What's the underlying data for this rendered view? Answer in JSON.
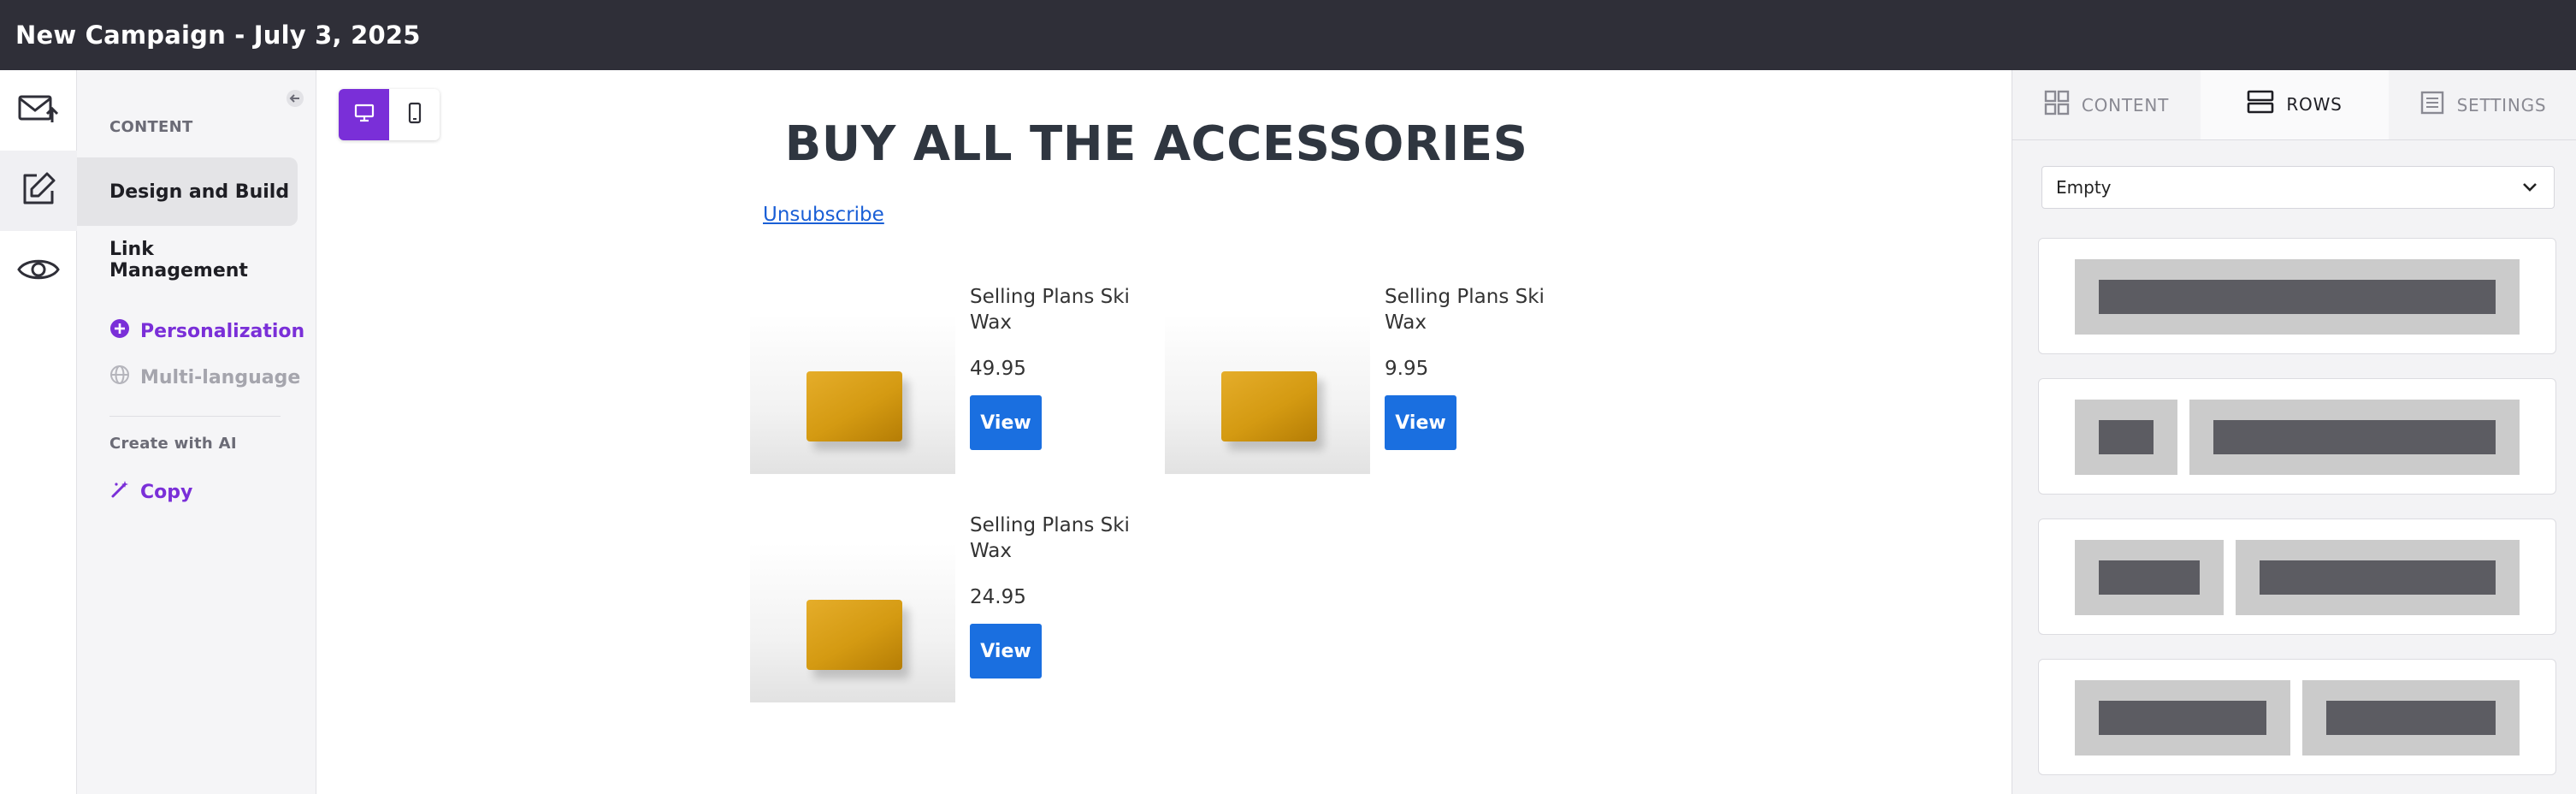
{
  "app": {
    "title": "New Campaign - July 3, 2025"
  },
  "rail": {
    "items": [
      {
        "name": "send-icon",
        "active": false
      },
      {
        "name": "edit-icon",
        "active": true
      },
      {
        "name": "preview-icon",
        "active": false
      }
    ]
  },
  "sidebar": {
    "section_label": "CONTENT",
    "items": [
      {
        "label": "Design and Build",
        "active": true
      },
      {
        "label": "Link Management",
        "active": false
      }
    ],
    "personalization": "Personalization",
    "multi_language": "Multi-language",
    "ai_label": "Create with AI",
    "copy": "Copy",
    "colors": {
      "accent": "#7a2fd8",
      "muted": "#a5a5ad"
    }
  },
  "canvas": {
    "device_toggle": {
      "desktop": "desktop-icon",
      "mobile": "mobile-icon",
      "selected": "desktop"
    },
    "email": {
      "headline": "BUY ALL THE ACCESSORIES",
      "unsubscribe": "Unsubscribe",
      "products": [
        {
          "name": "Selling Plans Ski Wax",
          "price": "49.95",
          "button": "View"
        },
        {
          "name": "Selling Plans Ski Wax",
          "price": "9.95",
          "button": "View"
        },
        {
          "name": "Selling Plans Ski Wax",
          "price": "24.95",
          "button": "View"
        }
      ]
    }
  },
  "right_panel": {
    "tabs": [
      {
        "label": "CONTENT",
        "icon": "grid-icon",
        "active": false
      },
      {
        "label": "ROWS",
        "icon": "rows-icon",
        "active": true
      },
      {
        "label": "SETTINGS",
        "icon": "settings-list-icon",
        "active": false
      }
    ],
    "row_select": {
      "value": "Empty"
    },
    "row_layouts": [
      "1 column",
      "1/4 + 3/4",
      "1/3 + 2/3",
      "1/2 + 1/2"
    ]
  }
}
